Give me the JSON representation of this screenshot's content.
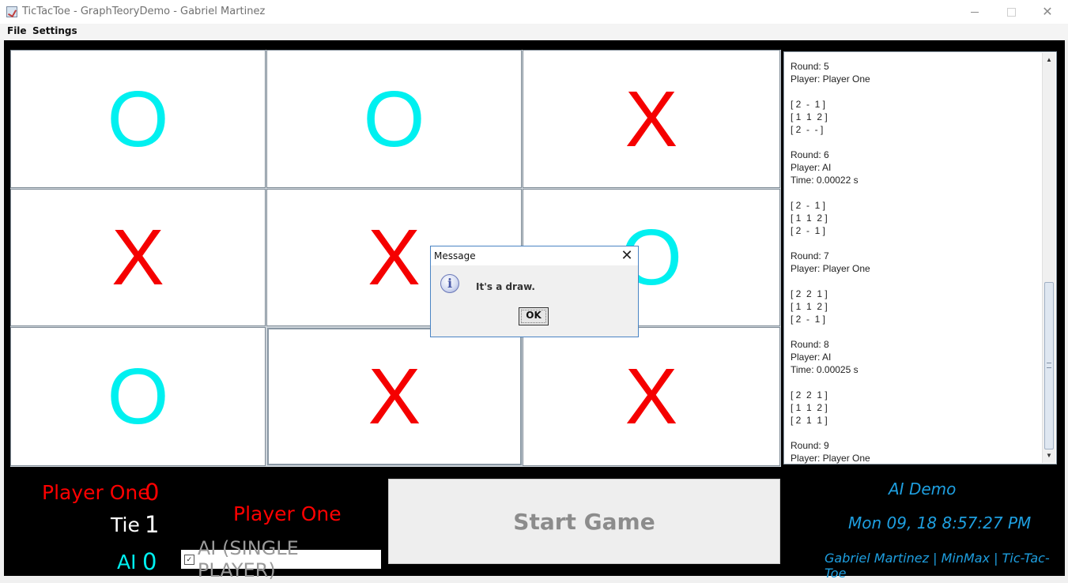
{
  "window": {
    "title": "TicTacToe - GraphTeoryDemo - Gabriel Martinez"
  },
  "menu": [
    "File",
    "Settings"
  ],
  "board": {
    "cells": [
      "O",
      "O",
      "X",
      "X",
      "X",
      "O",
      "O",
      "X",
      "X"
    ],
    "colors": {
      "x": "#f50000",
      "o": "#00f0f0"
    }
  },
  "log": {
    "text": "Round: 5\nPlayer: Player One\n\n[ 2  -  1 ]\n[ 1  1  2 ]\n[ 2  -  - ]\n\nRound: 6\nPlayer: AI\nTime: 0.00022 s\n\n[ 2  -  1 ]\n[ 1  1  2 ]\n[ 2  -  1 ]\n\nRound: 7\nPlayer: Player One\n\n[ 2  2  1 ]\n[ 1  1  2 ]\n[ 2  -  1 ]\n\nRound: 8\nPlayer: AI\nTime: 0.00025 s\n\n[ 2  2  1 ]\n[ 1  1  2 ]\n[ 2  1  1 ]\n\nRound: 9\nPlayer: Player One"
  },
  "score": {
    "player_one_label": "Player One",
    "player_one_value": "0",
    "tie_label": "Tie",
    "tie_value": "1",
    "ai_label": "AI",
    "ai_value": "0"
  },
  "turn_label": "Player One",
  "ai_mode": {
    "label": "AI (SINGLE PLAYER)",
    "checked": true
  },
  "start_button": "Start Game",
  "info": {
    "mode": "AI Demo",
    "datetime": "Mon 09, 18 8:57:27 PM",
    "credits": "Gabriel Martinez | MinMax | Tic-Tac-Toe"
  },
  "dialog": {
    "title": "Message",
    "message": "It's a draw.",
    "ok_label": "OK",
    "icon": "info-icon"
  }
}
